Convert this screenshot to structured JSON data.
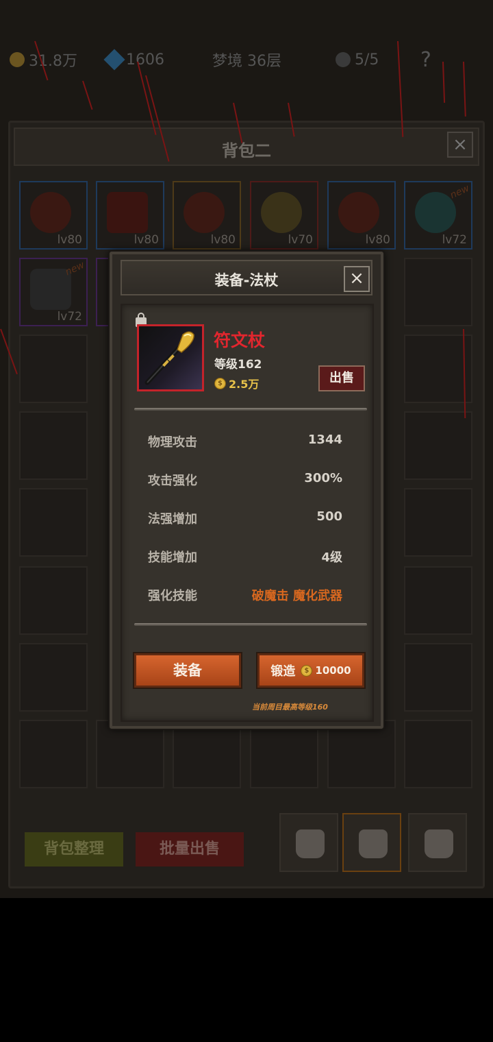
{
  "hud": {
    "gold": "31.8万",
    "gems": "1606",
    "stage": "梦境 36层",
    "energy": "5/5",
    "help": "?"
  },
  "bag": {
    "title": "背包二",
    "close": "×",
    "slots_row1": [
      {
        "lv": "lv80"
      },
      {
        "lv": "lv80"
      },
      {
        "lv": "lv80"
      },
      {
        "lv": "lv70"
      },
      {
        "lv": "lv80"
      },
      {
        "lv": "lv72",
        "tag": "new"
      }
    ],
    "slots_row2": [
      {
        "lv": "lv72",
        "tag": "new"
      }
    ],
    "sort_label": "背包整理",
    "batch_sell_label": "批量出售"
  },
  "modal": {
    "title": "装备-法杖",
    "close": "×",
    "item": {
      "name": "符文杖",
      "level": "等级162",
      "price": "2.5万"
    },
    "sell_label": "出售",
    "stats": [
      {
        "label": "物理攻击",
        "value": "1344"
      },
      {
        "label": "攻击强化",
        "value": "300%"
      },
      {
        "label": "法强增加",
        "value": "500"
      },
      {
        "label": "技能增加",
        "value": "4级"
      },
      {
        "label": "强化技能",
        "value": "破魔击 魔化武器"
      }
    ],
    "equip_label": "装备",
    "forge_label": "锻造",
    "forge_cost": "10000",
    "note": "当前周目最高等级160"
  },
  "colors": {
    "item_name": "#e2262e",
    "skill_text": "#d9681f",
    "button": "#c0562a"
  }
}
